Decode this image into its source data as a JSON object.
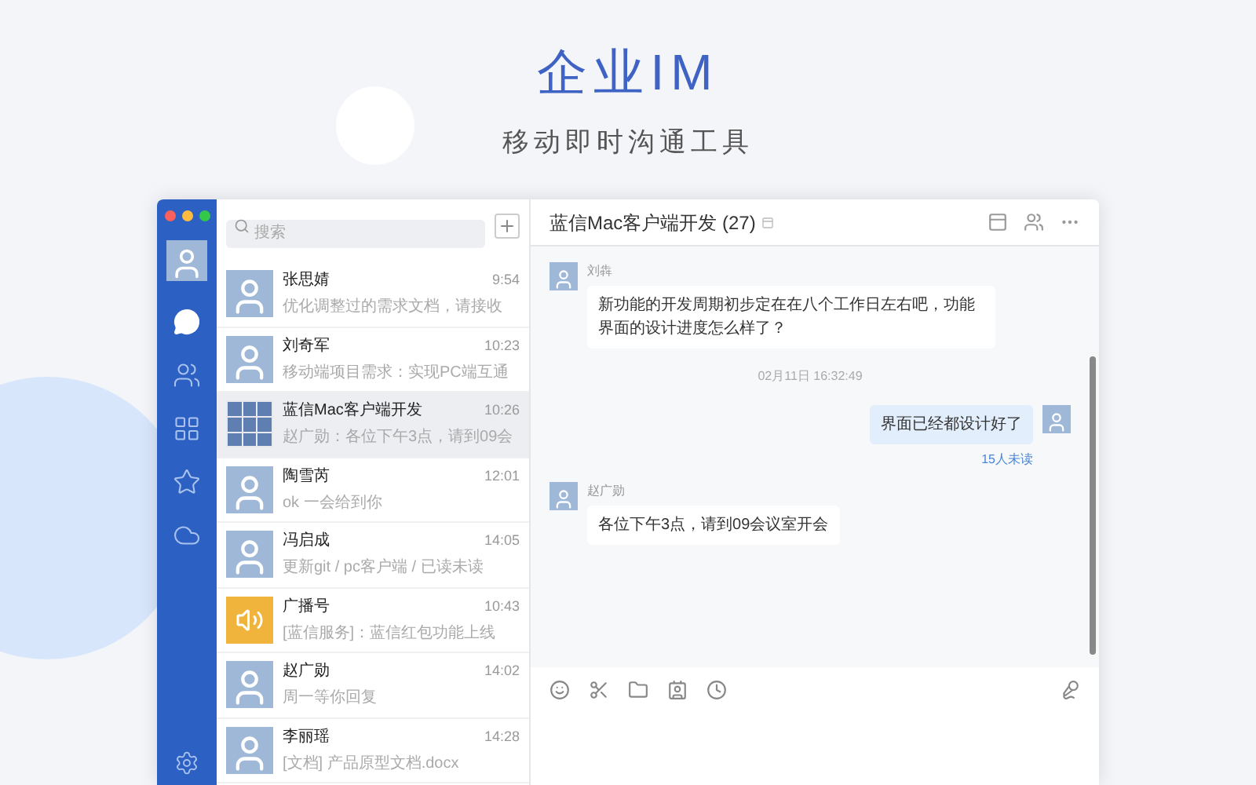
{
  "hero": {
    "title": "企业IM",
    "subtitle": "移动即时沟通工具"
  },
  "rail": [
    {
      "kind": "chat",
      "selected": true
    },
    {
      "kind": "contacts",
      "selected": false
    },
    {
      "kind": "apps",
      "selected": false
    },
    {
      "kind": "star",
      "selected": false
    },
    {
      "kind": "cloud",
      "selected": false
    }
  ],
  "search": {
    "placeholder": "搜索"
  },
  "conversations": [
    {
      "kind": "person",
      "name": "张思婧",
      "time": "9:54",
      "preview": "优化调整过的需求文档，请接收",
      "selected": false
    },
    {
      "kind": "person",
      "name": "刘奇军",
      "time": "10:23",
      "preview": "移动端项目需求：实现PC端互通",
      "selected": false
    },
    {
      "kind": "group",
      "name": "蓝信Mac客户端开发",
      "time": "10:26",
      "preview": "赵广勋：各位下午3点，请到09会",
      "selected": true
    },
    {
      "kind": "person",
      "name": "陶雪芮",
      "time": "12:01",
      "preview": "ok 一会给到你",
      "selected": false
    },
    {
      "kind": "person",
      "name": "冯启成",
      "time": "14:05",
      "preview": "更新git / pc客户端 / 已读未读",
      "selected": false
    },
    {
      "kind": "broadcast",
      "name": "广播号",
      "time": "10:43",
      "preview": "[蓝信服务]：蓝信红包功能上线",
      "selected": false
    },
    {
      "kind": "person",
      "name": "赵广勋",
      "time": "14:02",
      "preview": "周一等你回复",
      "selected": false
    },
    {
      "kind": "person",
      "name": "李丽瑶",
      "time": "14:28",
      "preview": "[文档] 产品原型文档.docx",
      "selected": false
    }
  ],
  "chat": {
    "title": "蓝信Mac客户端开发 (27)",
    "messages": [
      {
        "kind": "incoming",
        "sender": "刘犇",
        "text": "新功能的开发周期初步定在在八个工作日左右吧，功能界面的设计进度怎么样了？"
      },
      {
        "kind": "timestamp",
        "text": "02月11日 16:32:49"
      },
      {
        "kind": "outgoing",
        "text": "界面已经都设计好了",
        "status": "15人未读"
      },
      {
        "kind": "incoming",
        "sender": "赵广勋",
        "text": "各位下午3点，请到09会议室开会"
      }
    ]
  }
}
